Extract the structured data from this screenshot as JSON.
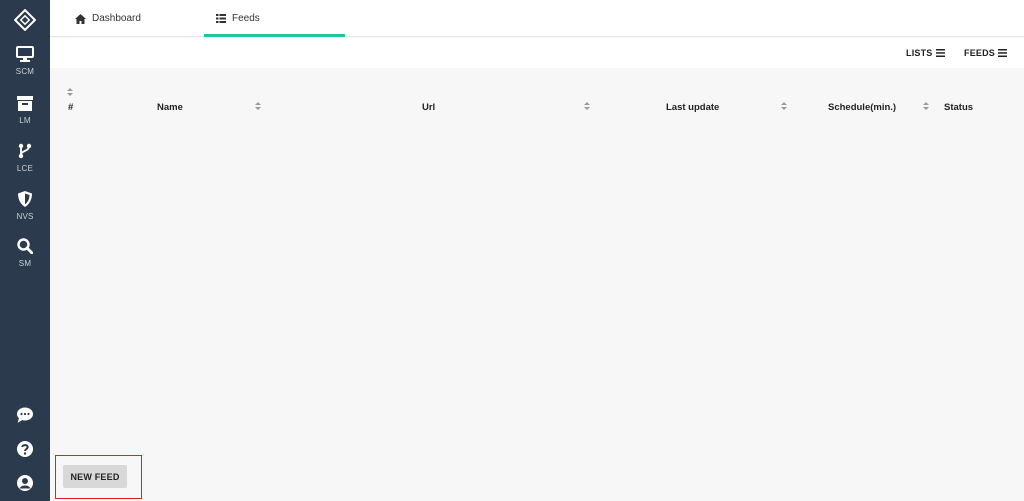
{
  "sidebar": {
    "items": [
      {
        "label": "SCM",
        "icon": "monitor-icon"
      },
      {
        "label": "LM",
        "icon": "archive-icon"
      },
      {
        "label": "LCE",
        "icon": "branch-icon"
      },
      {
        "label": "NVS",
        "icon": "shield-icon"
      },
      {
        "label": "SM",
        "icon": "search-icon"
      }
    ],
    "bottom_icons": [
      "chat-icon",
      "help-icon",
      "user-icon"
    ]
  },
  "tabs": [
    {
      "label": "Dashboard",
      "icon": "home-icon",
      "active": false
    },
    {
      "label": "Feeds",
      "icon": "list-icon",
      "active": true
    }
  ],
  "toolbar": {
    "lists_label": "LISTS",
    "feeds_label": "FEEDS"
  },
  "table": {
    "columns": [
      "#",
      "Name",
      "Url",
      "Last update",
      "Schedule(min.)",
      "Status"
    ],
    "rows": []
  },
  "actions": {
    "new_feed_label": "NEW FEED"
  },
  "colors": {
    "sidebar_bg": "#2b3a4d",
    "accent": "#20c4a4",
    "highlight_border": "#e02020"
  }
}
